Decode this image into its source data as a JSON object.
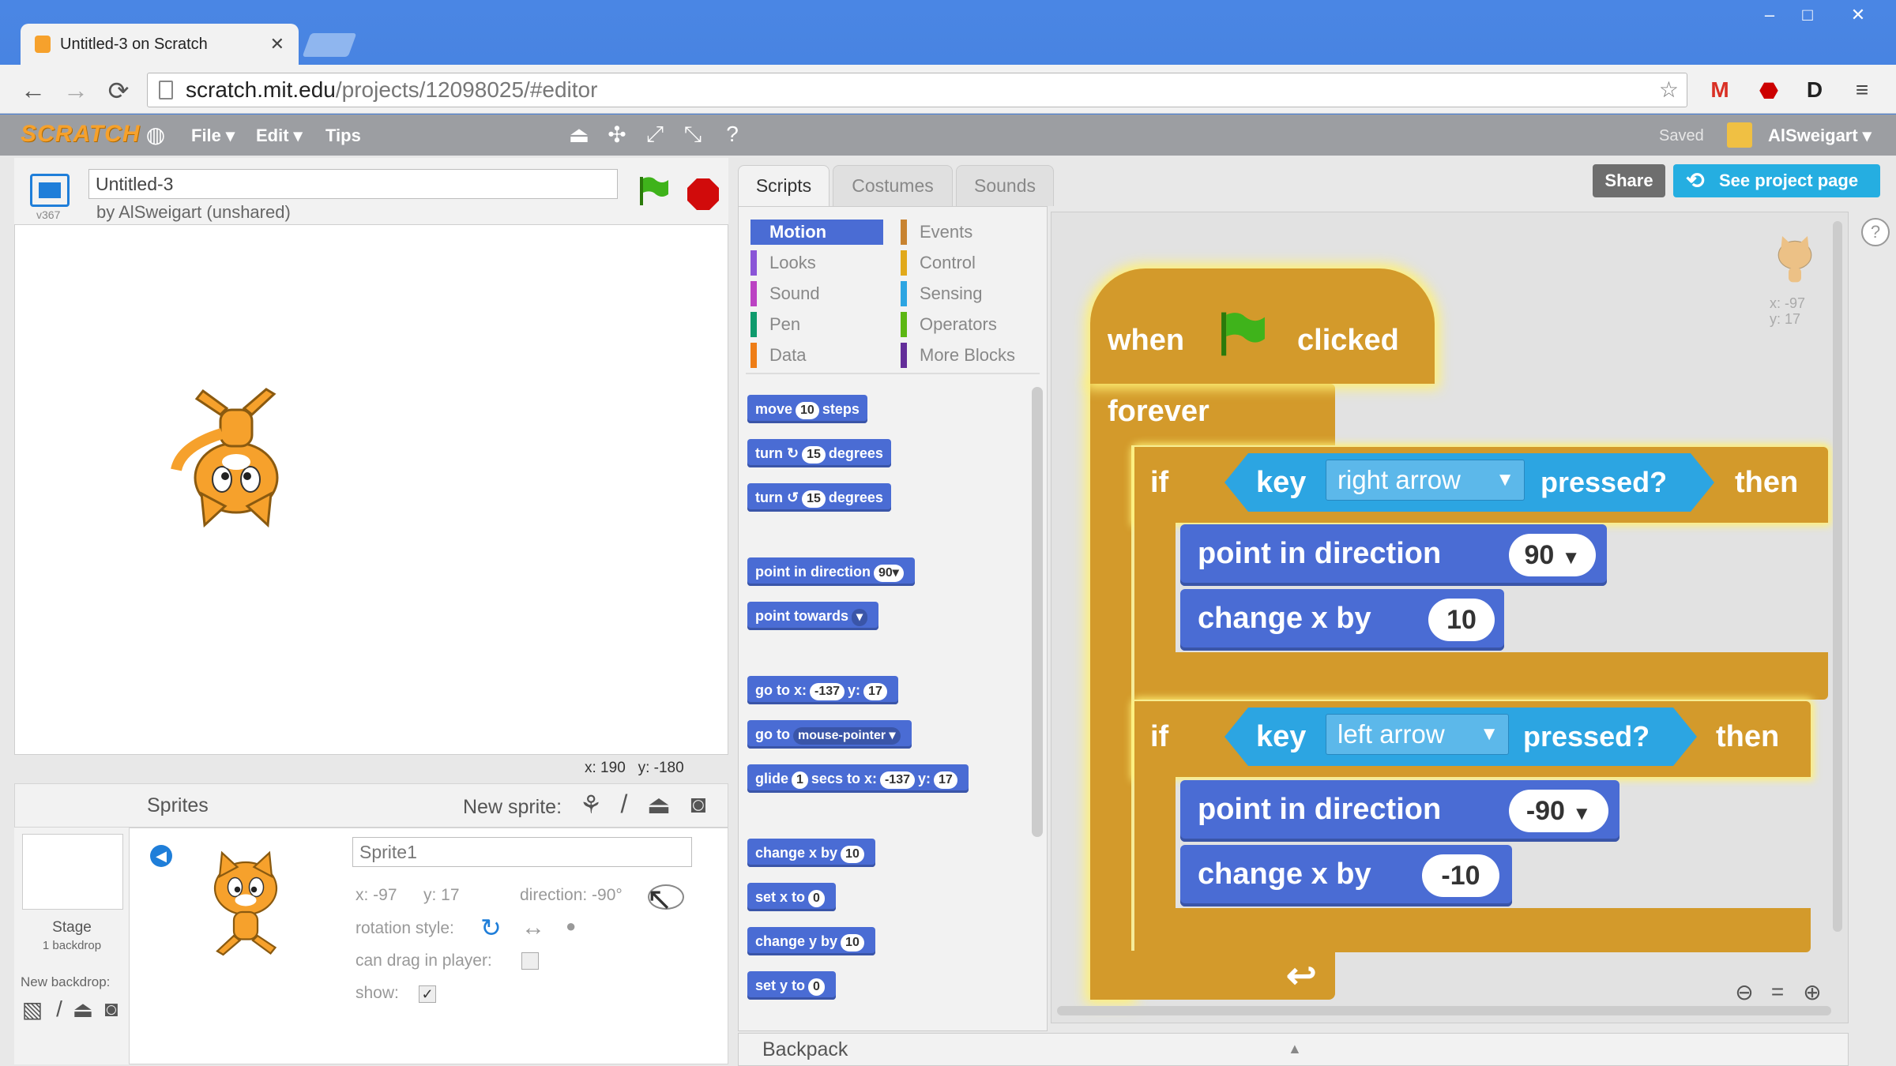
{
  "browser": {
    "tab_title": "Untitled-3 on Scratch",
    "tab_close": "✕",
    "url_host": "scratch.mit.edu",
    "url_path": "/projects/12098025/#editor",
    "win_min": "–",
    "win_max": "□",
    "win_close": "✕"
  },
  "menu": {
    "logo": "SCRATCH",
    "file": "File ▾",
    "edit": "Edit ▾",
    "tips": "Tips",
    "saved": "Saved",
    "username": "AlSweigart ▾"
  },
  "project": {
    "version": "v367",
    "title": "Untitled-3",
    "byline": "by AlSweigart (unshared)",
    "share_label": "Share",
    "see_page_label": "See project page"
  },
  "stage": {
    "mouse_x": "x: 190",
    "mouse_y": "y: -180"
  },
  "sprites": {
    "header": "Sprites",
    "new_sprite": "New sprite:",
    "stage_label": "Stage",
    "backdrop_count": "1 backdrop",
    "new_backdrop": "New backdrop:",
    "sprite_name": "Sprite1",
    "x": "x: -97",
    "y": "y: 17",
    "direction": "direction: -90°",
    "rotation_style": "rotation style:",
    "can_drag": "can drag in player:",
    "show": "show:"
  },
  "editor_tabs": [
    "Scripts",
    "Costumes",
    "Sounds"
  ],
  "categories": [
    {
      "label": "Motion",
      "color": "#4a6cd4"
    },
    {
      "label": "Looks",
      "color": "#8a55d7"
    },
    {
      "label": "Sound",
      "color": "#bb42c3"
    },
    {
      "label": "Pen",
      "color": "#0e9a6c"
    },
    {
      "label": "Data",
      "color": "#ee7d16"
    },
    {
      "label": "Events",
      "color": "#c88330"
    },
    {
      "label": "Control",
      "color": "#e1a91a"
    },
    {
      "label": "Sensing",
      "color": "#2ca5e2"
    },
    {
      "label": "Operators",
      "color": "#5cb712"
    },
    {
      "label": "More Blocks",
      "color": "#632d99"
    }
  ],
  "palette": {
    "move": {
      "pre": "move",
      "val": "10",
      "post": "steps"
    },
    "turn_right": {
      "pre": "turn ↻",
      "val": "15",
      "post": "degrees"
    },
    "turn_left": {
      "pre": "turn ↺",
      "val": "15",
      "post": "degrees"
    },
    "point_dir": {
      "pre": "point in direction",
      "val": "90▾"
    },
    "point_towards": {
      "pre": "point towards",
      "val": "▾"
    },
    "goto_xy": {
      "pre": "go to x:",
      "x": "-137",
      "mid": "y:",
      "y": "17"
    },
    "goto": {
      "pre": "go to",
      "val": "mouse-pointer ▾"
    },
    "glide": {
      "pre": "glide",
      "secs": "1",
      "mid": "secs to x:",
      "x": "-137",
      "mid2": "y:",
      "y": "17"
    },
    "change_x": {
      "pre": "change x by",
      "val": "10"
    },
    "set_x": {
      "pre": "set x to",
      "val": "0"
    },
    "change_y": {
      "pre": "change y by",
      "val": "10"
    },
    "set_y": {
      "pre": "set y to",
      "val": "0"
    }
  },
  "script": {
    "when": "when",
    "clicked": "clicked",
    "forever": "forever",
    "if1": "if",
    "key1": "key",
    "key1_val": "right arrow",
    "pressed1": "pressed?",
    "then1": "then",
    "point1": "point in direction",
    "point1_val": "90",
    "change1": "change x by",
    "change1_val": "10",
    "if2": "if",
    "key2": "key",
    "key2_val": "left arrow",
    "pressed2": "pressed?",
    "then2": "then",
    "point2": "point in direction",
    "point2_val": "-90",
    "change2": "change x by",
    "change2_val": "-10"
  },
  "sprite_pos": {
    "x": "x: -97",
    "y": "y: 17"
  },
  "backpack": "Backpack"
}
